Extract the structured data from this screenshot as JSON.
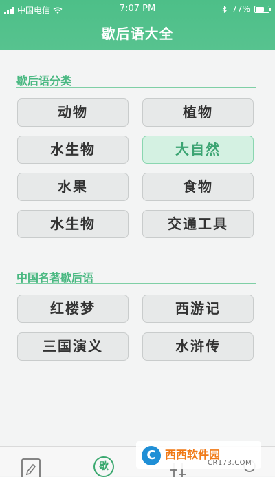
{
  "status_bar": {
    "carrier": "中国电信",
    "time": "7:07 PM",
    "battery": "77%",
    "battery_level": 0.77
  },
  "header": {
    "title": "歇后语大全"
  },
  "section1": {
    "title": "歇后语分类",
    "buttons": [
      {
        "label": "动物"
      },
      {
        "label": "植物"
      },
      {
        "label": "水生物"
      },
      {
        "label": "大自然"
      },
      {
        "label": "水果"
      },
      {
        "label": "食物"
      },
      {
        "label": "水生物"
      },
      {
        "label": "交通工具"
      }
    ]
  },
  "section2": {
    "title": "中国名著歇后语",
    "buttons": [
      {
        "label": "红楼梦"
      },
      {
        "label": "西游记"
      },
      {
        "label": "三国演义"
      },
      {
        "label": "水浒传"
      }
    ]
  },
  "tabbar": {
    "tabs": [
      {
        "icon": "edit-icon"
      },
      {
        "icon": "xie-circle-icon",
        "label": "歇"
      },
      {
        "icon": "settings-sliders-icon"
      },
      {
        "icon": "user-icon"
      }
    ]
  },
  "watermark": {
    "badge": "C",
    "text": "西西软件园",
    "sub": "CR173.COM"
  },
  "colors": {
    "accent": "#4dbf88",
    "active_button_bg": "#d4f1e2",
    "active_button_text": "#3ba472"
  }
}
